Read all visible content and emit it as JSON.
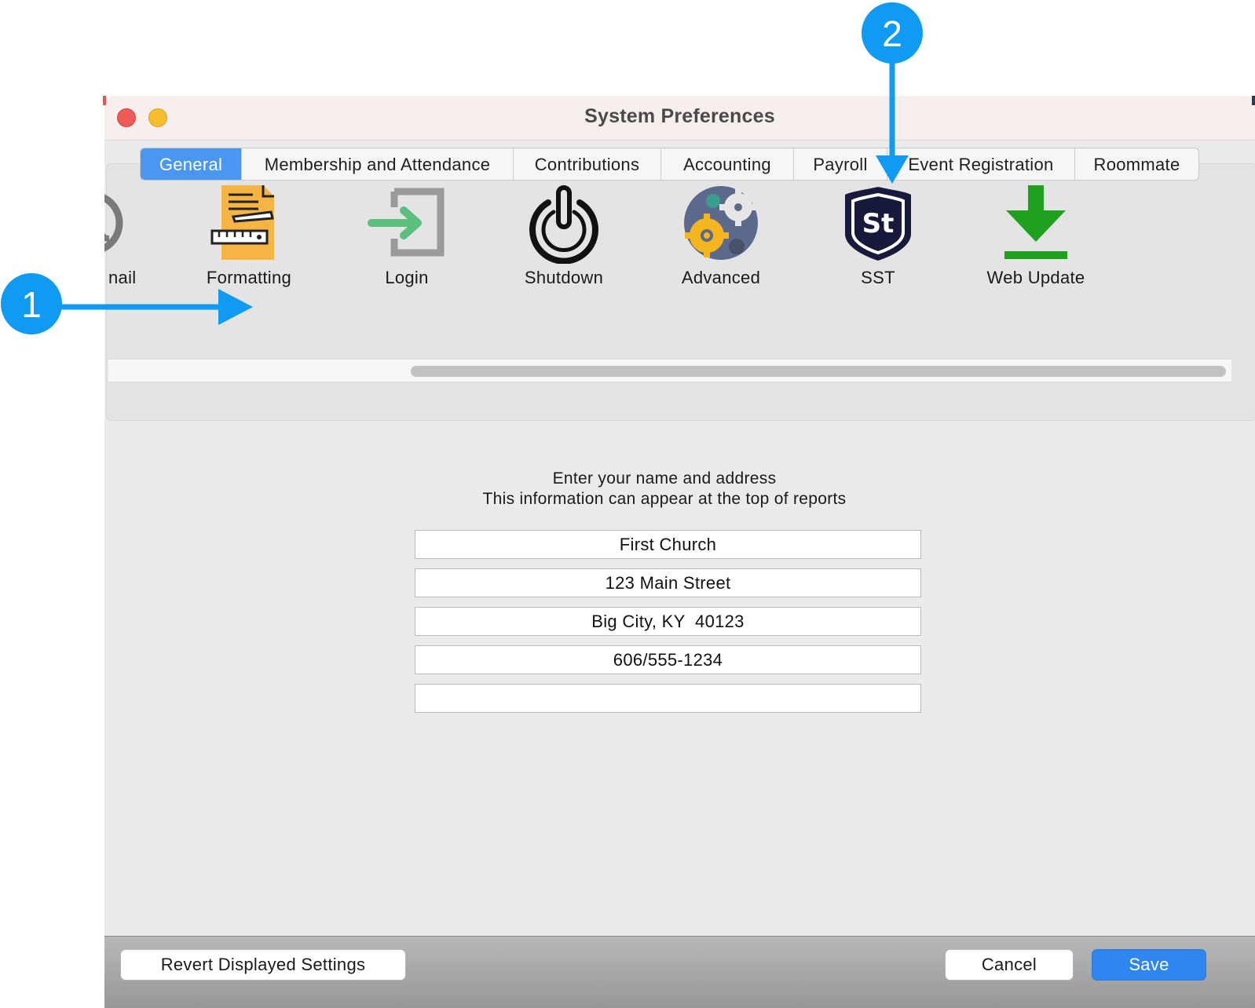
{
  "window": {
    "title": "System Preferences"
  },
  "tabs": [
    {
      "label": "General",
      "active": true
    },
    {
      "label": "Membership and Attendance",
      "active": false
    },
    {
      "label": "Contributions",
      "active": false
    },
    {
      "label": "Accounting",
      "active": false
    },
    {
      "label": "Payroll",
      "active": false
    },
    {
      "label": "Event Registration",
      "active": false
    },
    {
      "label": "Roommate",
      "active": false
    }
  ],
  "toolbar_icons": [
    {
      "label": "nail",
      "icon": "email-icon"
    },
    {
      "label": "Formatting",
      "icon": "formatting-icon"
    },
    {
      "label": "Login",
      "icon": "login-icon"
    },
    {
      "label": "Shutdown",
      "icon": "power-icon"
    },
    {
      "label": "Advanced",
      "icon": "gears-icon"
    },
    {
      "label": "SST",
      "icon": "sst-shield-icon"
    },
    {
      "label": "Web Update",
      "icon": "download-icon"
    }
  ],
  "main": {
    "prompt_line1": "Enter your name and address",
    "prompt_line2": "This information can appear at the top of reports",
    "fields": [
      {
        "value": "First Church"
      },
      {
        "value": "123 Main Street"
      },
      {
        "value": "Big City, KY  40123"
      },
      {
        "value": "606/555-1234"
      },
      {
        "value": ""
      }
    ]
  },
  "footer": {
    "revert_label": "Revert Displayed Settings",
    "cancel_label": "Cancel",
    "save_label": "Save"
  },
  "callouts": [
    {
      "number": "1"
    },
    {
      "number": "2"
    }
  ],
  "colors": {
    "accent": "#4a97f2",
    "save_button": "#2f86f0",
    "callout": "#0f9bf3",
    "window_bg": "#ebebeb"
  }
}
